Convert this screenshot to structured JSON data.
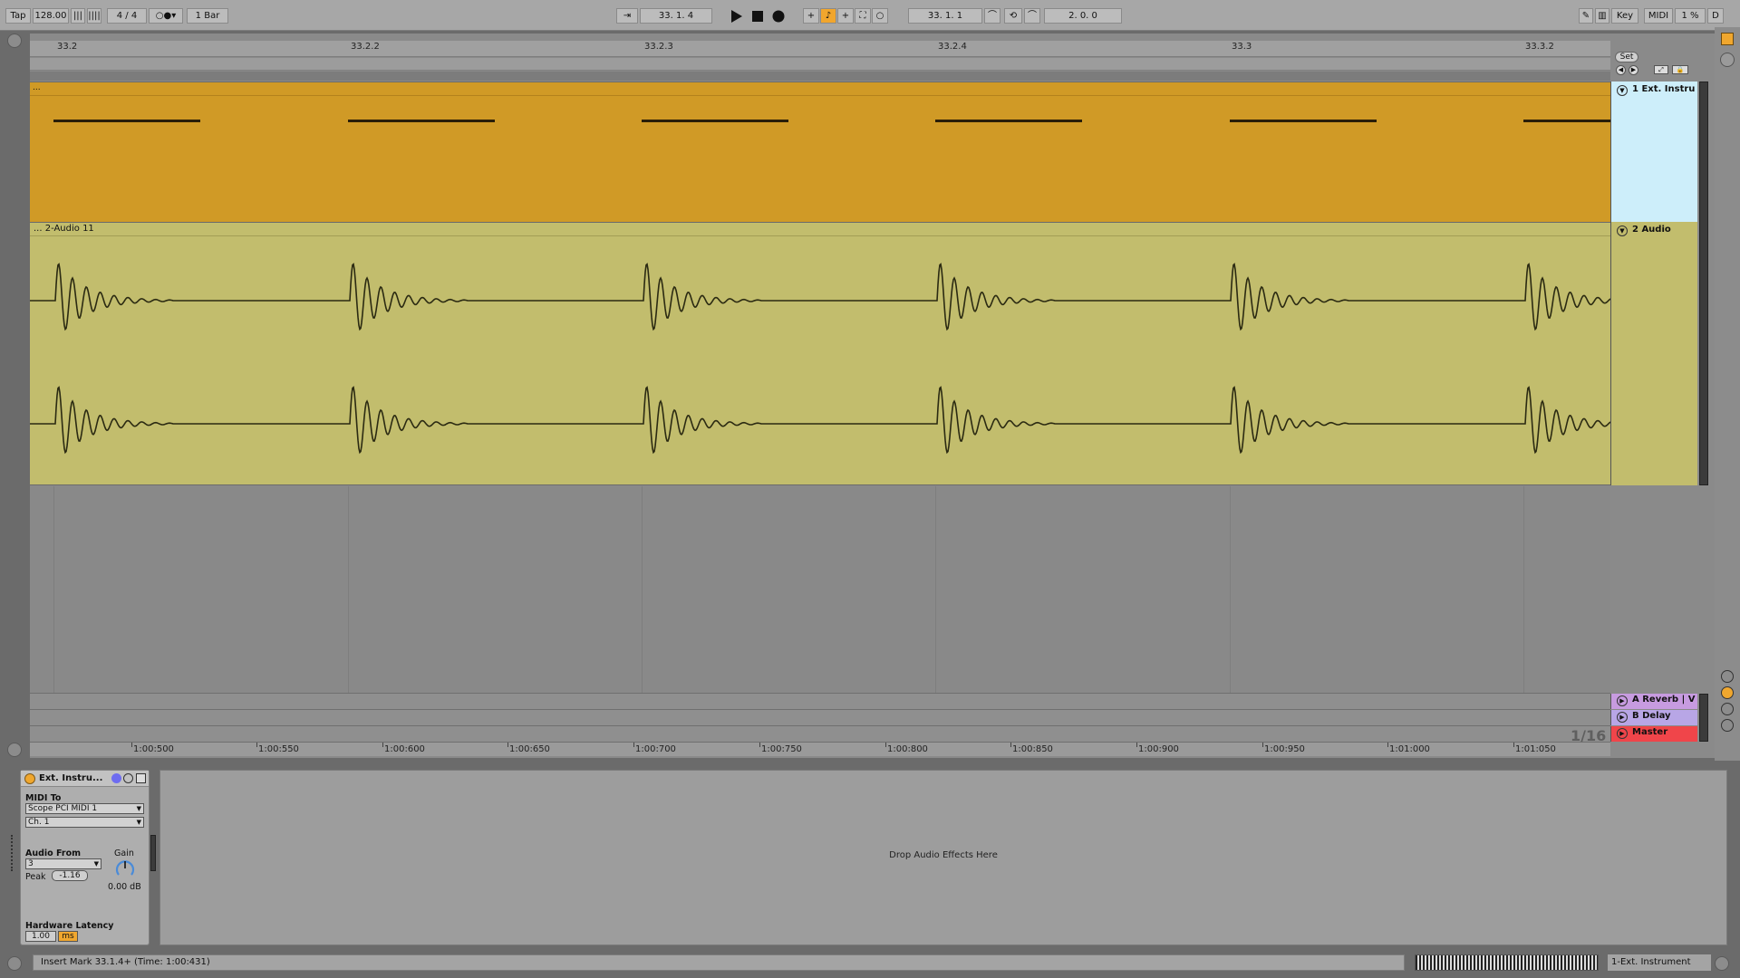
{
  "control_bar": {
    "tap_label": "Tap",
    "tempo": "128.00",
    "time_signature": "4 / 4",
    "quantize": "1 Bar",
    "position": "33.  1.  4",
    "loop_start": "33.  1.  1",
    "loop_length": "2.  0.  0",
    "key_label": "Key",
    "midi_label": "MIDI",
    "cpu_label": "1 %",
    "d_label": "D"
  },
  "ruler": {
    "bars": [
      "33.2",
      "33.2.2",
      "33.2.3",
      "33.2.4",
      "33.3",
      "33.3.2"
    ]
  },
  "set_label": "Set",
  "tracks": [
    {
      "name": "1 Ext. Instru",
      "clip_name": "...",
      "color": "#d09a26",
      "header_color": "#cdeefa"
    },
    {
      "name": "2 Audio",
      "clip_name": "... 2-Audio 11",
      "color": "#c2bd6d",
      "header_color": "#c2bd6d"
    }
  ],
  "returns": [
    {
      "name": "A Reverb | V",
      "color": "#c79be0"
    },
    {
      "name": "B Delay",
      "color": "#b8a6e6"
    },
    {
      "name": "Master",
      "color": "#f0454a"
    }
  ],
  "zoom_label": "1/16",
  "time_ruler": [
    "1:00:500",
    "1:00:550",
    "1:00:600",
    "1:00:650",
    "1:00:700",
    "1:00:750",
    "1:00:800",
    "1:00:850",
    "1:00:900",
    "1:00:950",
    "1:01:000",
    "1:01:050"
  ],
  "device": {
    "name": "Ext. Instru...",
    "midi_to_label": "MIDI To",
    "midi_to_value": "Scope PCI MIDI 1",
    "channel_value": "Ch. 1",
    "audio_from_label": "Audio From",
    "audio_from_value": "3",
    "gain_label": "Gain",
    "gain_value": "0.00 dB",
    "peak_label": "Peak",
    "peak_value": "-1.16",
    "latency_label": "Hardware Latency",
    "latency_value": "1.00",
    "latency_unit": "ms"
  },
  "drop_zone_text": "Drop Audio Effects Here",
  "status_text": "Insert Mark 33.1.4+ (Time: 1:00:431)",
  "selected_track_label": "1-Ext. Instrument"
}
